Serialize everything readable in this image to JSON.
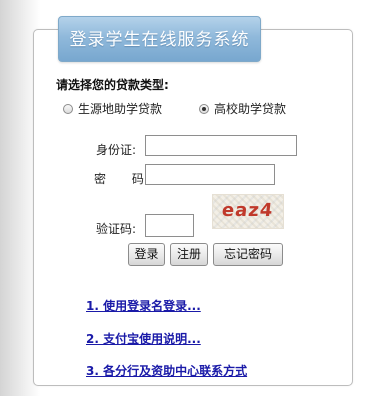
{
  "panel": {
    "title": "登录学生在线服务系统"
  },
  "loan_type": {
    "label": "请选择您的贷款类型:",
    "options": [
      {
        "label": "生源地助学贷款",
        "checked": false
      },
      {
        "label": "高校助学贷款",
        "checked": true
      }
    ]
  },
  "form": {
    "id_label": "身份证:",
    "password_label": "密 码:",
    "captcha_label": "验证码:",
    "id_value": "",
    "password_value": "",
    "captcha_value": "",
    "captcha_image_text": "eaz4"
  },
  "buttons": {
    "login": "登录",
    "register": "注册",
    "forgot": "忘记密码"
  },
  "help_links": [
    "1. 使用登录名登录...",
    "2. 支付宝使用说明...",
    "3. 各分行及资助中心联系方式"
  ],
  "colors": {
    "title_tab": "#90b9db",
    "link": "#1a1aa8",
    "captcha_text": "#c0392b"
  }
}
